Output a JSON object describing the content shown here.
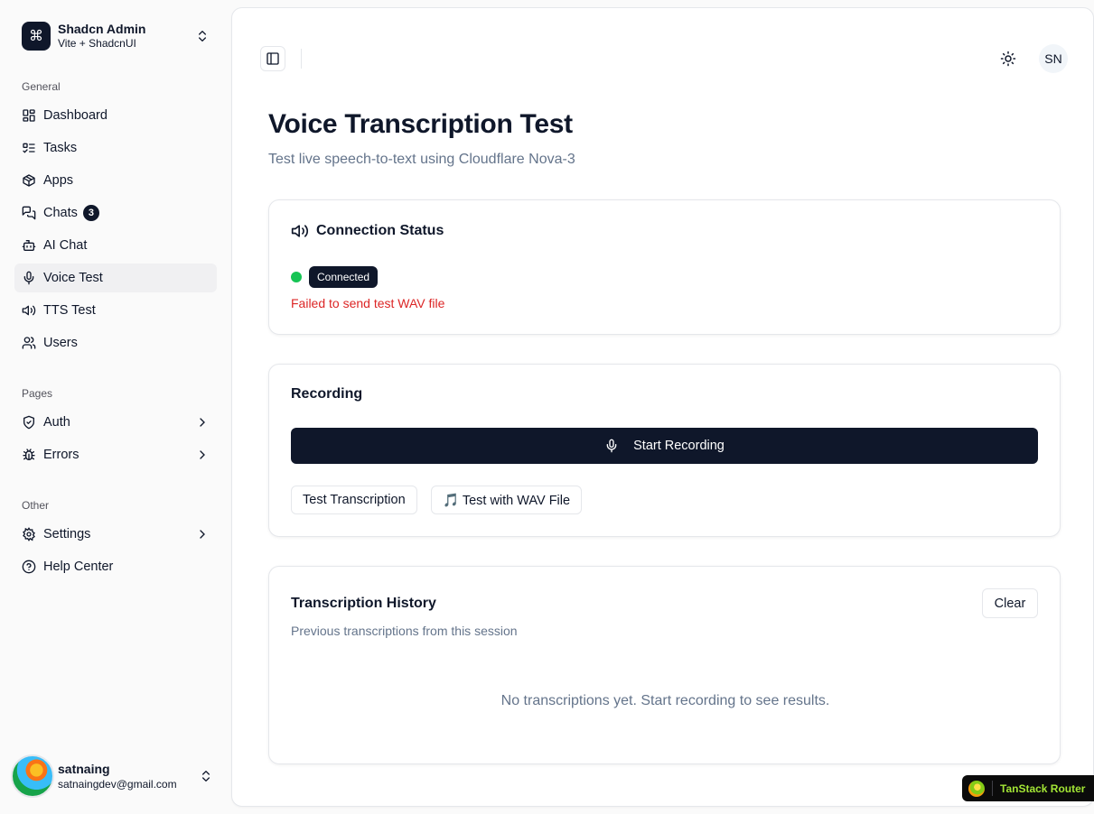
{
  "sidebar": {
    "team": {
      "name": "Shadcn Admin",
      "subtitle": "Vite + ShadcnUI",
      "logo_glyph": "⌘"
    },
    "groups": [
      {
        "label": "General"
      },
      {
        "label": "Pages"
      },
      {
        "label": "Other"
      }
    ],
    "items": [
      {
        "label": "Dashboard",
        "icon": "dashboard-icon"
      },
      {
        "label": "Tasks",
        "icon": "tasks-icon"
      },
      {
        "label": "Apps",
        "icon": "package-icon"
      },
      {
        "label": "Chats",
        "icon": "chats-icon",
        "badge": "3"
      },
      {
        "label": "AI Chat",
        "icon": "bot-icon"
      },
      {
        "label": "Voice Test",
        "icon": "mic-icon",
        "active": true
      },
      {
        "label": "TTS Test",
        "icon": "speaker-icon"
      },
      {
        "label": "Users",
        "icon": "users-icon"
      },
      {
        "label": "Auth",
        "icon": "shield-check-icon"
      },
      {
        "label": "Errors",
        "icon": "bug-icon"
      },
      {
        "label": "Settings",
        "icon": "gear-icon"
      },
      {
        "label": "Help Center",
        "icon": "help-circle-icon"
      }
    ],
    "user": {
      "name": "satnaing",
      "email": "satnaingdev@gmail.com"
    }
  },
  "header": {
    "avatar_initials": "SN"
  },
  "page": {
    "title": "Voice Transcription Test",
    "subtitle": "Test live speech-to-text using Cloudflare Nova-3"
  },
  "connection_card": {
    "title": "Connection Status",
    "status": "Connected",
    "status_color": "#16c454",
    "error": "Failed to send test WAV file",
    "error_color": "#dc2626"
  },
  "recording_card": {
    "title": "Recording",
    "start_label": "Start Recording",
    "test_transcription_label": "Test Transcription",
    "test_wav_label": "🎵 Test with WAV File"
  },
  "history_card": {
    "title": "Transcription History",
    "description": "Previous transcriptions from this session",
    "clear_label": "Clear",
    "empty_text": "No transcriptions yet. Start recording to see results."
  },
  "devtools": {
    "label": "TanStack Router"
  },
  "colors": {
    "primary": "#0f172a",
    "muted": "#64748b",
    "border": "#e5e7eb"
  }
}
